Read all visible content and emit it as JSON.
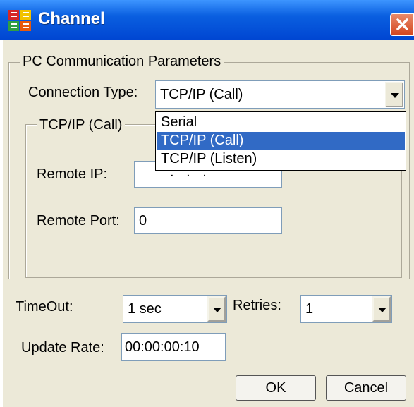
{
  "window": {
    "title": "Channel",
    "title_color": "#ffffff",
    "titlebar_color": "#0a5fe0"
  },
  "group_main": {
    "title": "PC Communication Parameters"
  },
  "connection": {
    "label": "Connection Type:",
    "value": "TCP/IP (Call)",
    "options": [
      "Serial",
      "TCP/IP (Call)",
      "TCP/IP (Listen)"
    ],
    "selected_index": 1
  },
  "group_tcp": {
    "title": "TCP/IP (Call)"
  },
  "remote_ip": {
    "label": "Remote IP:",
    "value": ".   .   ."
  },
  "remote_port": {
    "label": "Remote Port:",
    "value": "0"
  },
  "timeout": {
    "label": "TimeOut:",
    "value": "1 sec"
  },
  "retries": {
    "label": "Retries:",
    "value": "1"
  },
  "update_rate": {
    "label": "Update Rate:",
    "value": "00:00:00:10"
  },
  "buttons": {
    "ok": "OK",
    "cancel": "Cancel"
  },
  "colors": {
    "selection": "#316ac5",
    "dialog_bg": "#ece9d8"
  }
}
